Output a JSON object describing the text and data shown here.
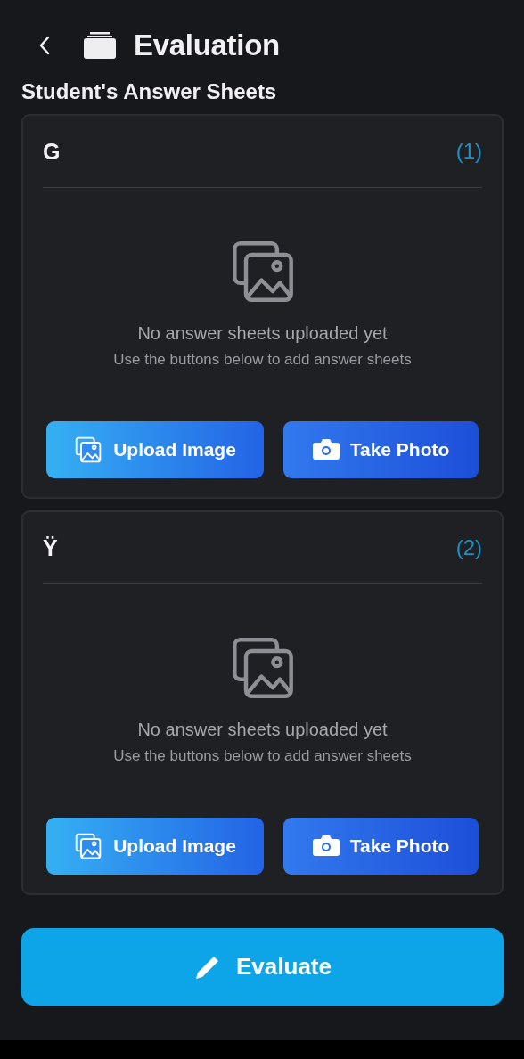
{
  "header": {
    "title": "Evaluation"
  },
  "section_title": "Student's Answer Sheets",
  "students": [
    {
      "name": "G",
      "index": "(1)",
      "empty_title": "No answer sheets uploaded yet",
      "empty_hint": "Use the buttons below to add answer sheets",
      "upload_label": "Upload Image",
      "photo_label": "Take Photo"
    },
    {
      "name": "Ÿ",
      "index": "(2)",
      "empty_title": "No answer sheets uploaded yet",
      "empty_hint": "Use the buttons below to add answer sheets",
      "upload_label": "Upload Image",
      "photo_label": "Take Photo"
    }
  ],
  "evaluate_button": {
    "label": "Evaluate"
  }
}
